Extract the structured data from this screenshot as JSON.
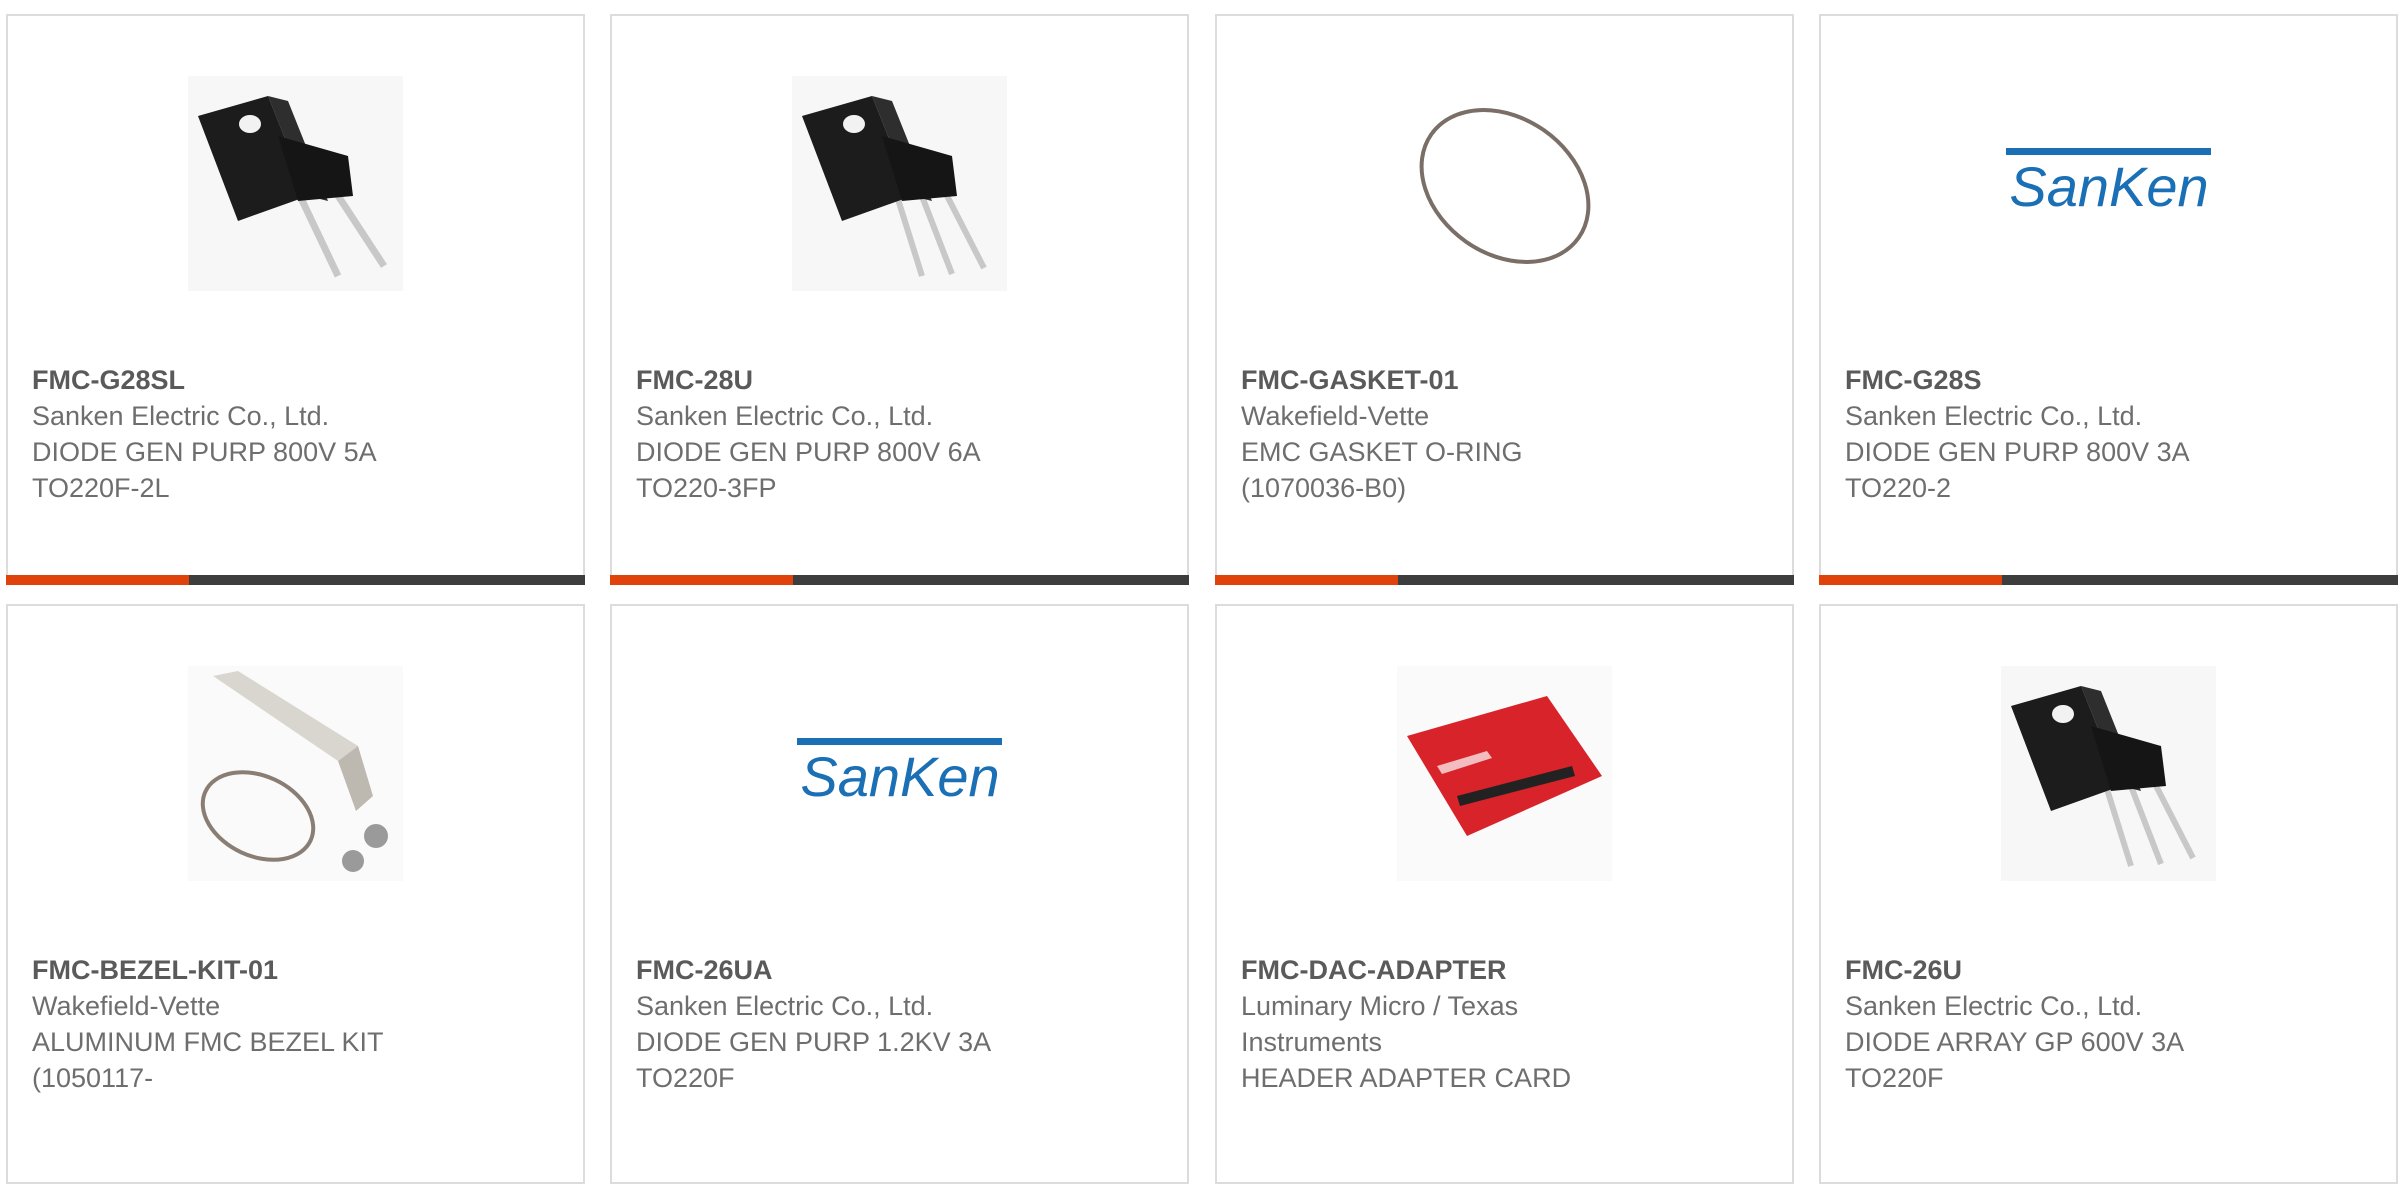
{
  "colors": {
    "accent": "#e0420c",
    "bar": "#3d3d3d",
    "border": "#dcdcdc",
    "text": "#6e6e6e",
    "sanken_blue": "#1a6fb5"
  },
  "products": [
    {
      "part_number": "FMC-G28SL",
      "manufacturer": "Sanken Electric Co., Ltd.",
      "desc_line1": "DIODE GEN PURP 800V 5A",
      "desc_line2": "TO220F-2L",
      "image": "to220-2-lead-icon"
    },
    {
      "part_number": "FMC-28U",
      "manufacturer": "Sanken Electric Co., Ltd.",
      "desc_line1": "DIODE GEN PURP 800V 6A",
      "desc_line2": "TO220-3FP",
      "image": "to220-3-lead-icon"
    },
    {
      "part_number": "FMC-GASKET-01",
      "manufacturer": "Wakefield-Vette",
      "desc_line1": "EMC GASKET O-RING",
      "desc_line2": "(1070036-B0)",
      "image": "o-ring-icon"
    },
    {
      "part_number": "FMC-G28S",
      "manufacturer": "Sanken Electric Co., Ltd.",
      "desc_line1": "DIODE GEN PURP 800V 3A",
      "desc_line2": "TO220-2",
      "image": "sanken-logo-icon",
      "logo_text": "SanKen"
    },
    {
      "part_number": "FMC-BEZEL-KIT-01",
      "manufacturer": "Wakefield-Vette",
      "desc_line1": "ALUMINUM FMC BEZEL KIT",
      "desc_line2": "(1050117-",
      "image": "bezel-kit-icon"
    },
    {
      "part_number": "FMC-26UA",
      "manufacturer": "Sanken Electric Co., Ltd.",
      "desc_line1": "DIODE GEN PURP 1.2KV 3A",
      "desc_line2": "TO220F",
      "image": "sanken-logo-icon",
      "logo_text": "SanKen"
    },
    {
      "part_number": "FMC-DAC-ADAPTER",
      "manufacturer": "Luminary Micro / Texas",
      "manufacturer_line2": "Instruments",
      "desc_line1": "HEADER ADAPTER CARD",
      "desc_line2": "",
      "image": "adapter-card-icon"
    },
    {
      "part_number": "FMC-26U",
      "manufacturer": "Sanken Electric Co., Ltd.",
      "desc_line1": "DIODE ARRAY GP 600V 3A",
      "desc_line2": "TO220F",
      "image": "to220-3-lead-icon"
    }
  ]
}
